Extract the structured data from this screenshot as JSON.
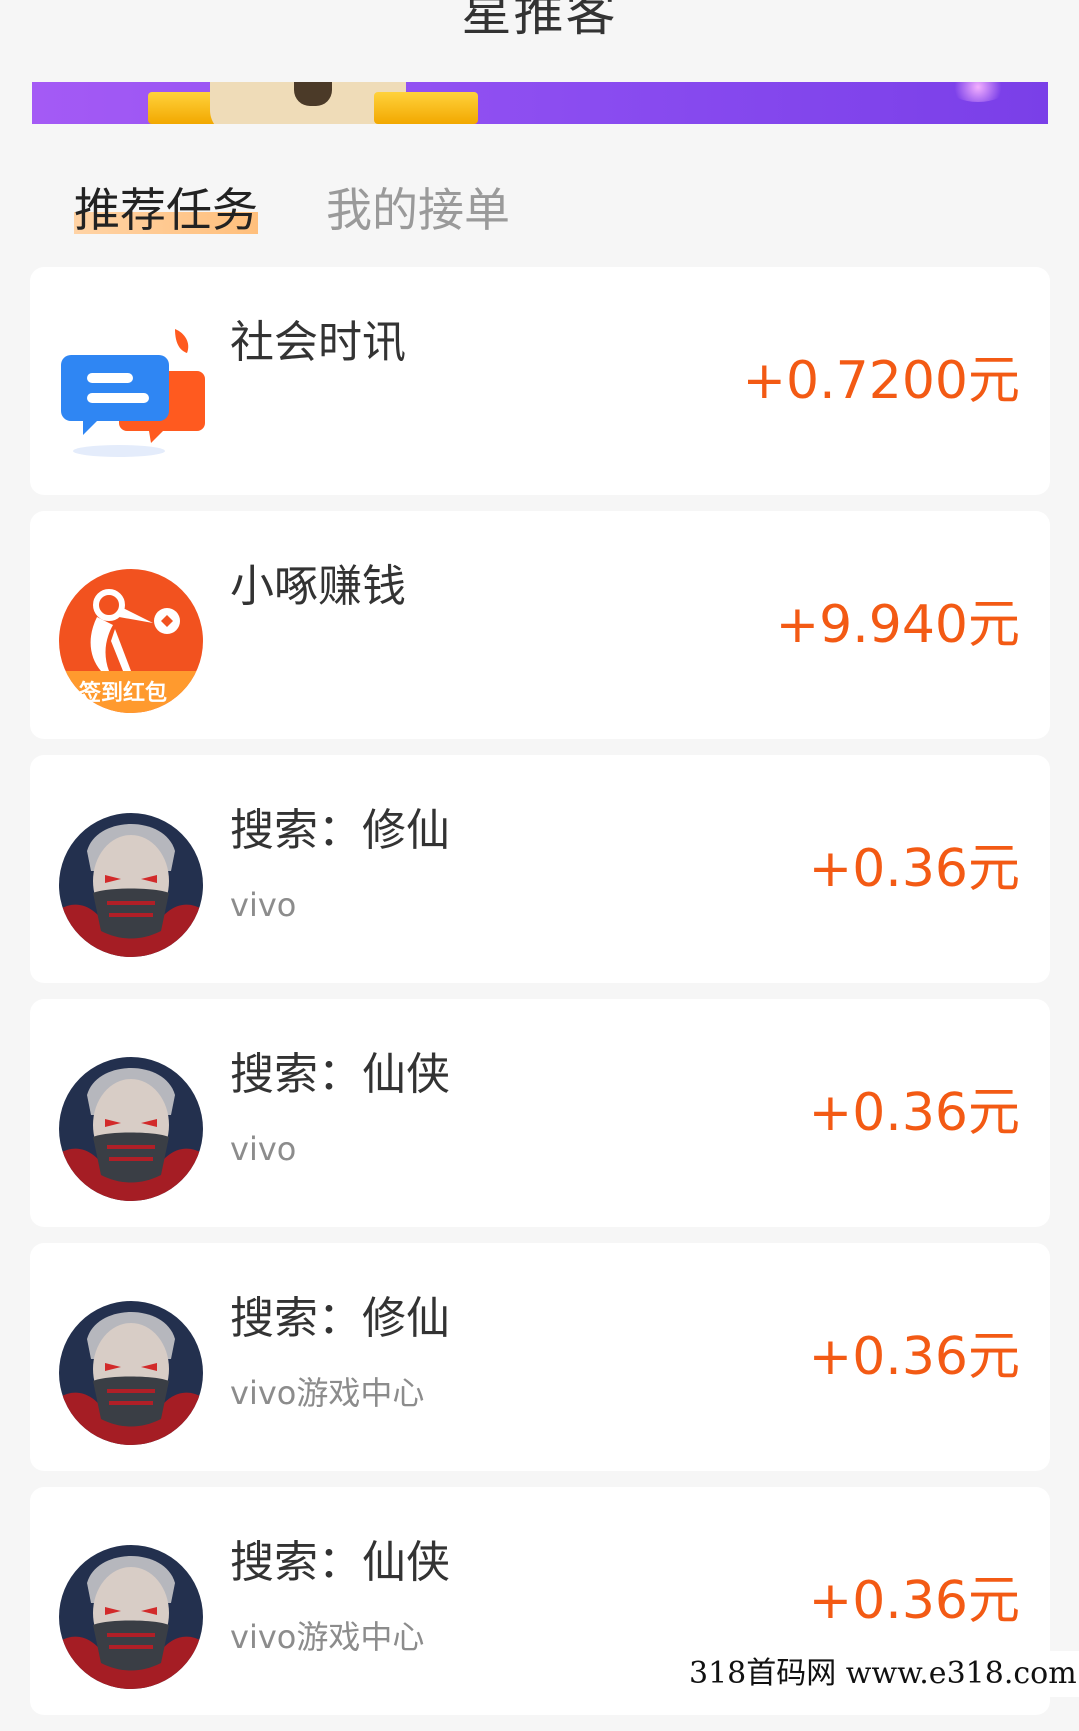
{
  "header": {
    "title": "星推客"
  },
  "tabs": [
    {
      "label": "推荐任务",
      "active": true
    },
    {
      "label": "我的接单",
      "active": false
    }
  ],
  "tasks": [
    {
      "title": "社会时讯",
      "subtitle": "",
      "reward": "+0.7200元",
      "icon": "chat-bubbles-icon"
    },
    {
      "title": "小啄赚钱",
      "subtitle": "",
      "reward": "+9.940元",
      "icon": "woodpecker-app-icon",
      "icon_badge": "签到红包"
    },
    {
      "title": "搜索：修仙",
      "subtitle": "vivo",
      "reward": "+0.36元",
      "icon": "masked-warrior-avatar-icon"
    },
    {
      "title": "搜索：仙侠",
      "subtitle": "vivo",
      "reward": "+0.36元",
      "icon": "masked-warrior-avatar-icon"
    },
    {
      "title": "搜索：修仙",
      "subtitle": "vivo游戏中心",
      "reward": "+0.36元",
      "icon": "masked-warrior-avatar-icon"
    },
    {
      "title": "搜索：仙侠",
      "subtitle": "vivo游戏中心",
      "reward": "+0.36元",
      "icon": "masked-warrior-avatar-icon"
    }
  ],
  "watermark": {
    "text": "318首码网  www.e318.com"
  },
  "colors": {
    "reward": "#f35a14",
    "tab_highlight": "#ffbf7c",
    "banner": "#8a4cf0"
  }
}
